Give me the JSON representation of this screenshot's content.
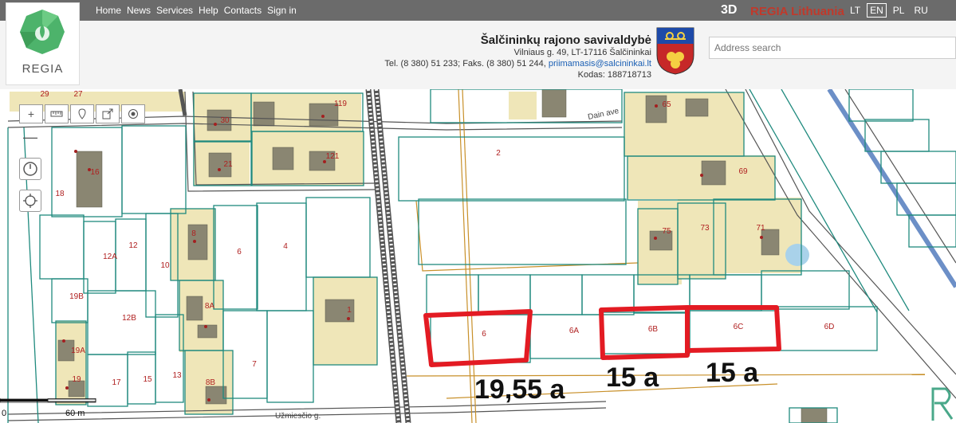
{
  "nav": {
    "items": [
      "Home",
      "News",
      "Services",
      "Help",
      "Contacts",
      "Sign in"
    ]
  },
  "topbar": {
    "mode_3d": "3D",
    "regia_lithuania": "REGIA Lithuania",
    "langs": [
      "LT",
      "EN",
      "PL",
      "RU"
    ],
    "active_lang": "EN"
  },
  "logo": {
    "text": "REGIA"
  },
  "municipality": {
    "name": "Šalčininkų rajono savivaldybė",
    "address": "Vilniaus g. 49, LT-17116 Šalčininkai",
    "phone_prefix": "Tel. (8 380) 51 233; Faks. (8 380) 51 244, ",
    "email": "priimamasis@salcininkai.lt",
    "code": "Kodas: 188718713"
  },
  "search": {
    "placeholder": "Address search"
  },
  "map": {
    "scale": {
      "zero": "0",
      "max": "60 m"
    },
    "street_labels": [
      "Dain ave",
      "Užmiesčio g."
    ],
    "parcels": [
      "29",
      "27",
      "119",
      "30",
      "65",
      "121",
      "21",
      "2",
      "69",
      "16",
      "18",
      "12",
      "4",
      "6",
      "73",
      "71",
      "75",
      "12A",
      "10",
      "8",
      "19B",
      "12B",
      "8A",
      "1",
      "19A",
      "7",
      "19",
      "17",
      "15",
      "13",
      "8B",
      "6",
      "6A",
      "6B",
      "6C",
      "6D"
    ],
    "areas": [
      "19,55 a",
      "15 a",
      "15 a"
    ]
  },
  "colors": {
    "parcel_line": "#1f8a7e",
    "parcel_label": "#b02020",
    "highlight": "#e31b23",
    "building_fill": "#efe6b8",
    "road": "#555555",
    "utility": "#c8902a"
  }
}
